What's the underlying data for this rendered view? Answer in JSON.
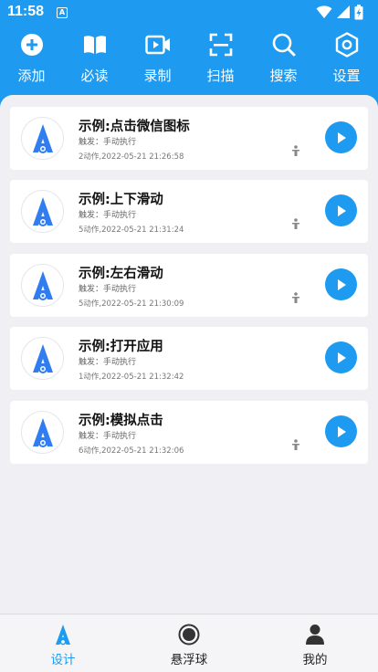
{
  "status_bar": {
    "time": "11:58",
    "app_badge": "A"
  },
  "colors": {
    "accent": "#1e9bf0",
    "background": "#f0f0f4",
    "card": "#ffffff"
  },
  "toolbar": {
    "items": [
      {
        "label": "添加",
        "icon": "add-icon"
      },
      {
        "label": "必读",
        "icon": "book-icon"
      },
      {
        "label": "录制",
        "icon": "video-record-icon"
      },
      {
        "label": "扫描",
        "icon": "scan-icon"
      },
      {
        "label": "搜索",
        "icon": "search-icon"
      },
      {
        "label": "设置",
        "icon": "settings-icon"
      }
    ]
  },
  "scripts": [
    {
      "title": "示例:点击微信图标",
      "trigger": "触发：手动执行",
      "meta": "2动作,2022-05-21 21:26:58"
    },
    {
      "title": "示例:上下滑动",
      "trigger": "触发：手动执行",
      "meta": "5动作,2022-05-21 21:31:24"
    },
    {
      "title": "示例:左右滑动",
      "trigger": "触发：手动执行",
      "meta": "5动作,2022-05-21 21:30:09"
    },
    {
      "title": "示例:打开应用",
      "trigger": "触发：手动执行",
      "meta": "1动作,2022-05-21 21:32:42"
    },
    {
      "title": "示例:模拟点击",
      "trigger": "触发：手动执行",
      "meta": "6动作,2022-05-21 21:32:06"
    }
  ],
  "tabbar": {
    "active": "设计",
    "items": [
      {
        "label": "设计",
        "icon": "design-logo-icon"
      },
      {
        "label": "悬浮球",
        "icon": "floating-ball-icon"
      },
      {
        "label": "我的",
        "icon": "profile-icon"
      }
    ]
  }
}
